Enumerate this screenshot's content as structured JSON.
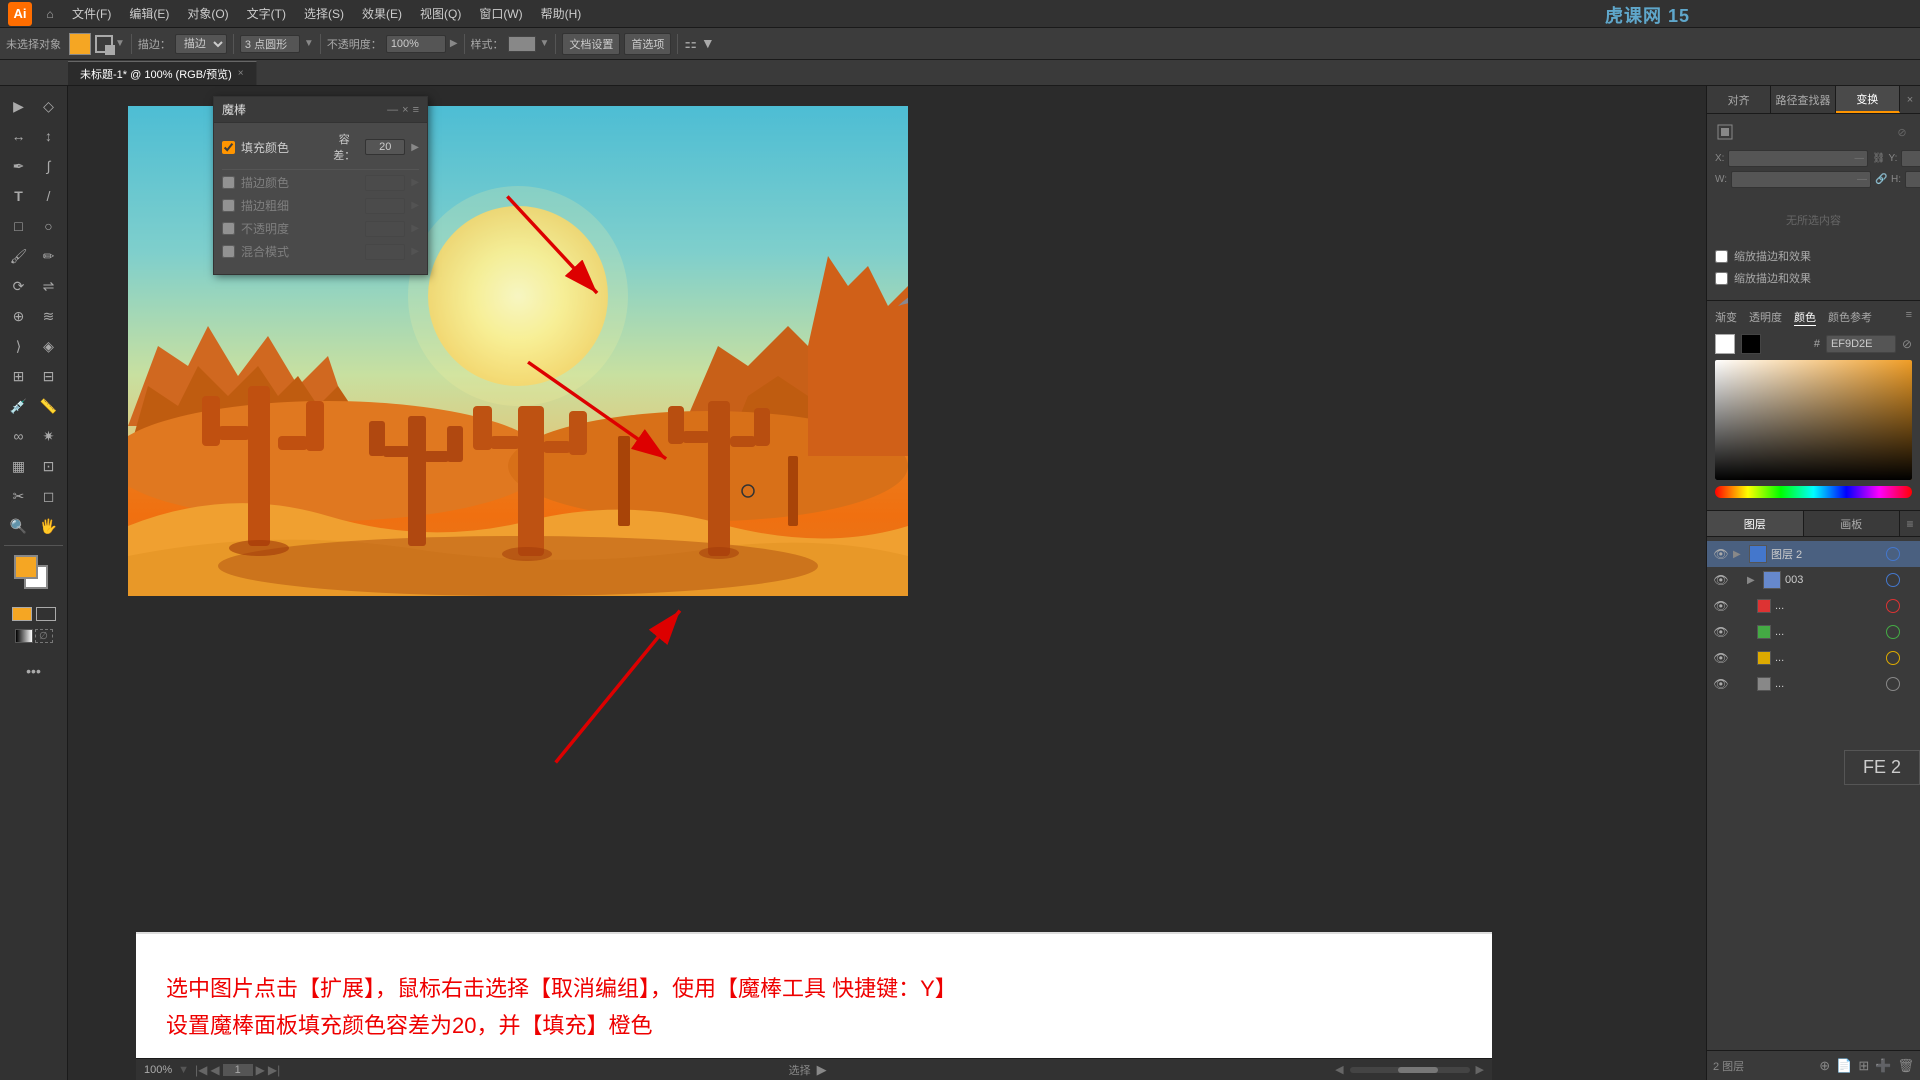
{
  "app": {
    "title": "Adobe Illustrator",
    "logo": "Ai",
    "watermark": "虎课网 15"
  },
  "menu": {
    "items": [
      "文件(F)",
      "编辑(E)",
      "对象(O)",
      "文字(T)",
      "选择(S)",
      "效果(E)",
      "视图(Q)",
      "窗口(W)",
      "帮助(H)"
    ]
  },
  "toolbar": {
    "label_stroke": "描边：",
    "label_3pt": "3 点圆形",
    "label_opacity": "不透明度：",
    "opacity_value": "100%",
    "label_style": "样式：",
    "btn_doc_settings": "文档设置",
    "btn_first_option": "首选项"
  },
  "tab": {
    "title": "未标题-1* @ 100% (RGB/预览)",
    "close": "×"
  },
  "tools": {
    "list": [
      "▶",
      "◇",
      "↕",
      "✏",
      "✒",
      "T",
      "/",
      "□",
      "○",
      "◌",
      "⟳",
      "☇",
      "✂",
      "⊕",
      "↔",
      "⊘",
      "⋯",
      "◈",
      "⊞",
      "🖐",
      "🔍"
    ]
  },
  "magic_wand_panel": {
    "title": "魔棒",
    "fill_color_label": "填充颜色",
    "fill_color_checked": true,
    "fill_tolerance_label": "容差：",
    "fill_tolerance_value": "20",
    "stroke_color_label": "描边颜色",
    "stroke_color_checked": false,
    "stroke_weight_label": "描边粗细",
    "stroke_weight_checked": false,
    "opacity_label": "不透明度",
    "opacity_checked": false,
    "blend_label": "混合模式",
    "blend_checked": false
  },
  "right_panel": {
    "tabs": [
      "对齐",
      "路径查找器",
      "变换"
    ],
    "active_tab": "变换",
    "close_label": "×",
    "no_selection": "无所选内容",
    "options": {
      "crop_label": "缩放描边和效果",
      "align_label": "缩放描边和效果"
    }
  },
  "color_panel": {
    "tabs": [
      "渐变",
      "透明度",
      "颜色",
      "颜色参考"
    ],
    "active_tab": "颜色",
    "hex_label": "#",
    "hex_value": "EF9D2E",
    "swatches": [
      "#ffffff",
      "#000000"
    ]
  },
  "layers_panel": {
    "tabs": [
      "图层",
      "画板"
    ],
    "active_tab": "图层",
    "layers": [
      {
        "name": "图层 2",
        "expanded": true,
        "visible": true,
        "locked": false,
        "color": "#4477cc",
        "indent": 0,
        "is_group": true
      },
      {
        "name": "003",
        "expanded": false,
        "visible": true,
        "locked": false,
        "color": "#4477cc",
        "indent": 1
      },
      {
        "name": "...",
        "expanded": false,
        "visible": true,
        "locked": false,
        "color": "#dd4444",
        "indent": 2
      },
      {
        "name": "...",
        "expanded": false,
        "visible": true,
        "locked": false,
        "color": "#44aa44",
        "indent": 2
      },
      {
        "name": "...",
        "expanded": false,
        "visible": true,
        "locked": false,
        "color": "#ddaa00",
        "indent": 2
      },
      {
        "name": "...",
        "expanded": false,
        "visible": true,
        "locked": false,
        "color": "#888888",
        "indent": 2
      }
    ],
    "footer": {
      "layer_count": "2 图层",
      "icons": [
        "make-layer",
        "new-layer",
        "new-artboard",
        "delete-layer"
      ]
    }
  },
  "instruction": {
    "line1": "选中图片点击【扩展】，鼠标右击选择【取消编组】，使用【魔棒工具 快捷键：Y】",
    "line2": "设置魔棒面板填充颜色容差为20，并【填充】橙色"
  },
  "status_bar": {
    "zoom": "100%",
    "page": "1",
    "label": "选择"
  },
  "fe2": {
    "label": "FE 2"
  }
}
